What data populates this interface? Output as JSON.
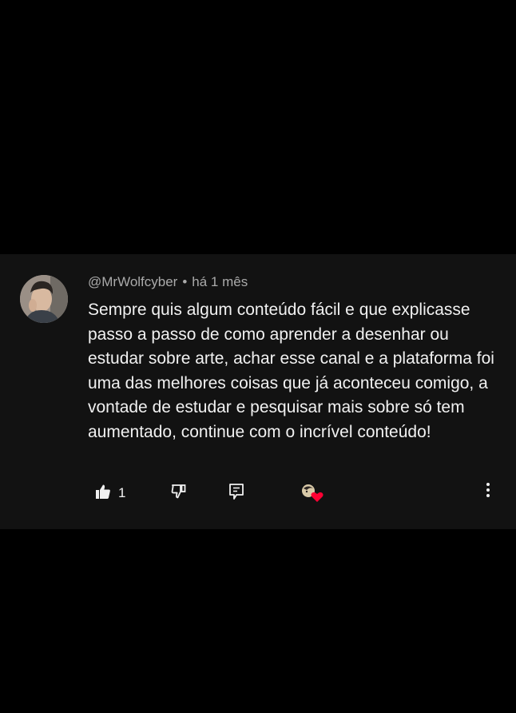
{
  "comment": {
    "author": "@MrWolfcyber",
    "separator": "•",
    "time": "há 1 mês",
    "text": "Sempre quis algum conteúdo fácil e que explicasse passo a passo de como aprender a desenhar ou estudar sobre arte, achar esse canal e a plataforma foi uma das melhores coisas que já aconteceu comigo, a vontade de estudar e pesquisar mais sobre só tem aumentado, continue com o incrível conteúdo!",
    "like_count": "1"
  },
  "icons": {
    "like": "thumbs-up-icon",
    "dislike": "thumbs-down-icon",
    "reply": "reply-comment-icon",
    "creator_heart": "creator-heart-icon",
    "more": "more-vertical-icon"
  },
  "colors": {
    "background": "#000000",
    "card": "#121212",
    "text": "#f1f1f1",
    "meta": "#aaaaaa",
    "heart": "#ff0033"
  }
}
